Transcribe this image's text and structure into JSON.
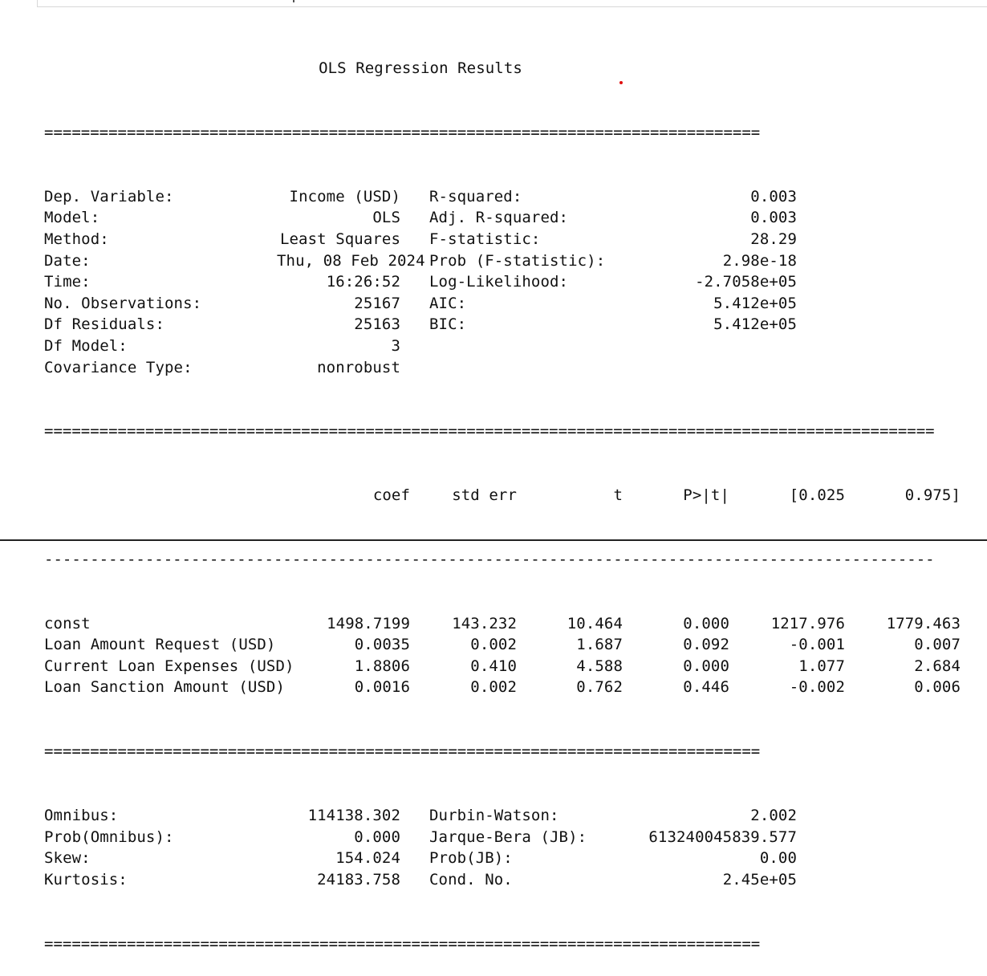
{
  "title": "OLS Regression Results",
  "separator_double": "==============================================================================",
  "separator_double_long": "=================================================================================================",
  "separator_single_long": "-------------------------------------------------------------------------------------------------",
  "summary": [
    {
      "left_label": "Dep. Variable:",
      "left_value": "Income (USD)",
      "right_label": "R-squared:",
      "right_value": "0.003"
    },
    {
      "left_label": "Model:",
      "left_value": "OLS",
      "right_label": "Adj. R-squared:",
      "right_value": "0.003"
    },
    {
      "left_label": "Method:",
      "left_value": "Least Squares",
      "right_label": "F-statistic:",
      "right_value": "28.29"
    },
    {
      "left_label": "Date:",
      "left_value": "Thu, 08 Feb 2024",
      "right_label": "Prob (F-statistic):",
      "right_value": "2.98e-18"
    },
    {
      "left_label": "Time:",
      "left_value": "16:26:52",
      "right_label": "Log-Likelihood:",
      "right_value": "-2.7058e+05"
    },
    {
      "left_label": "No. Observations:",
      "left_value": "25167",
      "right_label": "AIC:",
      "right_value": "5.412e+05"
    },
    {
      "left_label": "Df Residuals:",
      "left_value": "25163",
      "right_label": "BIC:",
      "right_value": "5.412e+05"
    },
    {
      "left_label": "Df Model:",
      "left_value": "3",
      "right_label": "",
      "right_value": ""
    },
    {
      "left_label": "Covariance Type:",
      "left_value": "nonrobust",
      "right_label": "",
      "right_value": ""
    }
  ],
  "coef_table": {
    "headers": [
      "",
      "coef",
      "std err",
      "t",
      "P>|t|",
      "[0.025",
      "0.975]"
    ],
    "rows": [
      [
        "const",
        "1498.7199",
        "143.232",
        "10.464",
        "0.000",
        "1217.976",
        "1779.463"
      ],
      [
        "Loan Amount Request (USD)",
        "0.0035",
        "0.002",
        "1.687",
        "0.092",
        "-0.001",
        "0.007"
      ],
      [
        "Current Loan Expenses (USD)",
        "1.8806",
        "0.410",
        "4.588",
        "0.000",
        "1.077",
        "2.684"
      ],
      [
        "Loan Sanction Amount (USD)",
        "0.0016",
        "0.002",
        "0.762",
        "0.446",
        "-0.002",
        "0.006"
      ]
    ]
  },
  "diagnostics": [
    {
      "left_label": "Omnibus:",
      "left_value": "114138.302",
      "right_label": "Durbin-Watson:",
      "right_value": "2.002"
    },
    {
      "left_label": "Prob(Omnibus):",
      "left_value": "0.000",
      "right_label": "Jarque-Bera (JB):",
      "right_value": "613240045839.577"
    },
    {
      "left_label": "Skew:",
      "left_value": "154.024",
      "right_label": "Prob(JB):",
      "right_value": "0.00"
    },
    {
      "left_label": "Kurtosis:",
      "left_value": "24183.758",
      "right_label": "Cond. No.",
      "right_value": "2.45e+05"
    }
  ],
  "colors": {
    "text": "#111111",
    "background": "#ffffff",
    "dot": "#e01010"
  }
}
